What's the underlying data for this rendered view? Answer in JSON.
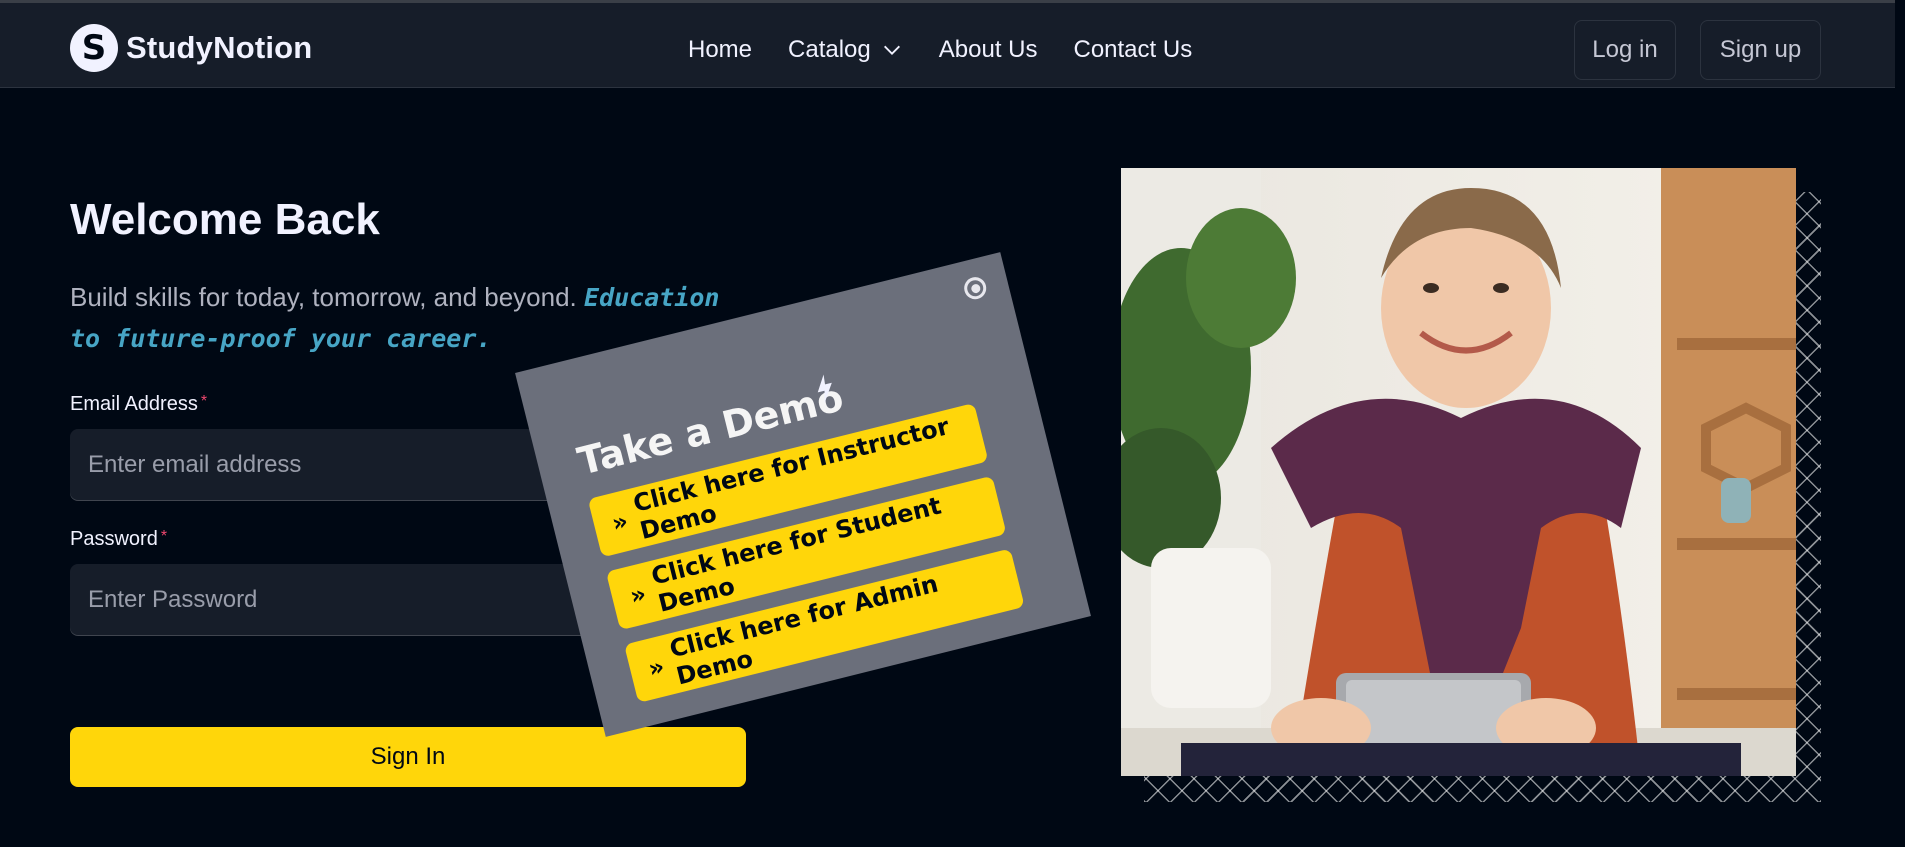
{
  "brand": {
    "logo_letter": "S",
    "name": "StudyNotion"
  },
  "nav": {
    "links": [
      {
        "label": "Home"
      },
      {
        "label": "Catalog"
      },
      {
        "label": "About Us"
      },
      {
        "label": "Contact Us"
      }
    ],
    "login_label": "Log in",
    "signup_label": "Sign up"
  },
  "login": {
    "title": "Welcome Back",
    "subtitle": "Build skills for today, tomorrow, and beyond.",
    "subtitle_highlight": "Education to future-proof your career.",
    "email_label": "Email Address",
    "email_placeholder": "Enter email address",
    "password_label": "Password",
    "password_placeholder": "Enter Password",
    "required_mark": "*",
    "signin_label": "Sign In"
  },
  "demo": {
    "title": "Take a Demo",
    "arrow_glyph": "»",
    "buttons": [
      {
        "label": "Click here for Instructor Demo"
      },
      {
        "label": "Click here for Student Demo"
      },
      {
        "label": "Click here for Admin Demo"
      }
    ]
  },
  "colors": {
    "background": "#000814",
    "accent_yellow": "#ffd60a",
    "highlight_blue": "#47a5c5",
    "popup_gray": "#6b6f7b"
  }
}
